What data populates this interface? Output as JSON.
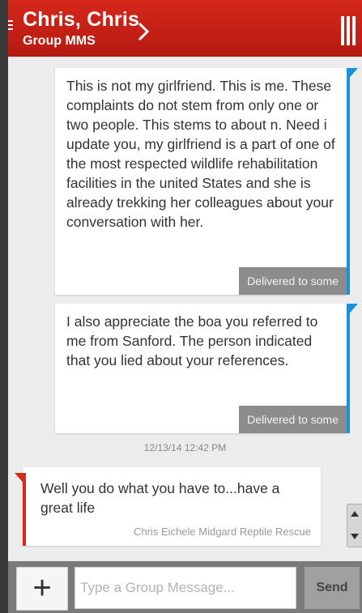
{
  "header": {
    "title": "Chris, Chris",
    "subtitle": "Group MMS"
  },
  "messages": {
    "outgoing": [
      {
        "text": "This is not my girlfriend. This is me. These complaints do not stem from only one or two people. This stems to about n. Need i update you, my girlfriend is a part of one of the most respected wildlife rehabilitation facilities in the united States and she is already trekking her colleagues about your conversation with her.",
        "status": "Delivered to some"
      },
      {
        "text": "I also appreciate the boa you referred to me from Sanford. The person indicated that you lied about your references.",
        "status": "Delivered to some"
      }
    ],
    "timestamp": "12/13/14 12:42 PM",
    "incoming": [
      {
        "text": "Well you do what you have to...have a great life",
        "sender": "Chris Eichele Midgard Reptile Rescue"
      }
    ]
  },
  "composer": {
    "add_label": "+",
    "placeholder": "Type a Group Message...",
    "send_label": "Send"
  },
  "colors": {
    "header": "#c8221a",
    "outgoing_accent": "#1e90d8",
    "incoming_accent": "#d52b1f"
  }
}
